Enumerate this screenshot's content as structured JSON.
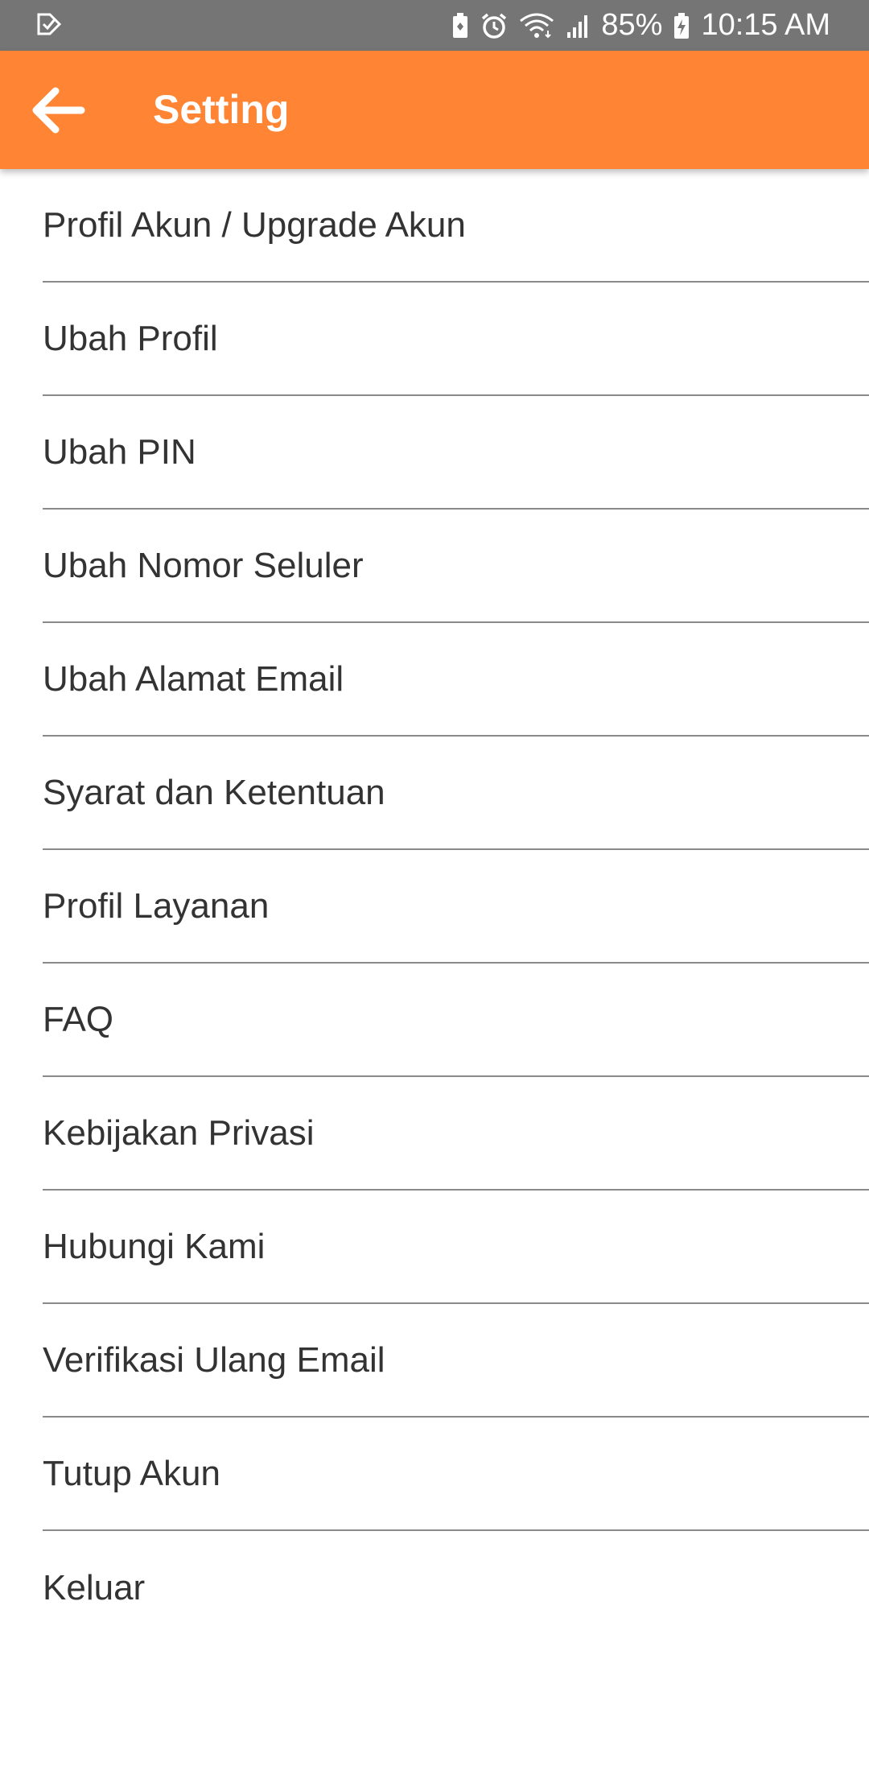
{
  "status_bar": {
    "battery_percent": "85%",
    "time": "10:15 AM",
    "left_icons": [
      "notification-check-icon"
    ],
    "right_icons": [
      "battery-saver-icon",
      "alarm-icon",
      "wifi-icon",
      "signal-icon",
      "battery-charging-icon"
    ]
  },
  "app_bar": {
    "title": "Setting",
    "back_icon": "arrow-left-icon",
    "background_color": "#ff8534"
  },
  "menu": {
    "items": [
      {
        "label": "Profil Akun / Upgrade Akun"
      },
      {
        "label": "Ubah Profil"
      },
      {
        "label": "Ubah PIN"
      },
      {
        "label": "Ubah Nomor Seluler"
      },
      {
        "label": "Ubah Alamat Email"
      },
      {
        "label": "Syarat dan Ketentuan"
      },
      {
        "label": "Profil Layanan"
      },
      {
        "label": "FAQ"
      },
      {
        "label": "Kebijakan Privasi"
      },
      {
        "label": "Hubungi Kami"
      },
      {
        "label": "Verifikasi Ulang Email"
      },
      {
        "label": "Tutup Akun"
      },
      {
        "label": "Keluar"
      }
    ]
  }
}
